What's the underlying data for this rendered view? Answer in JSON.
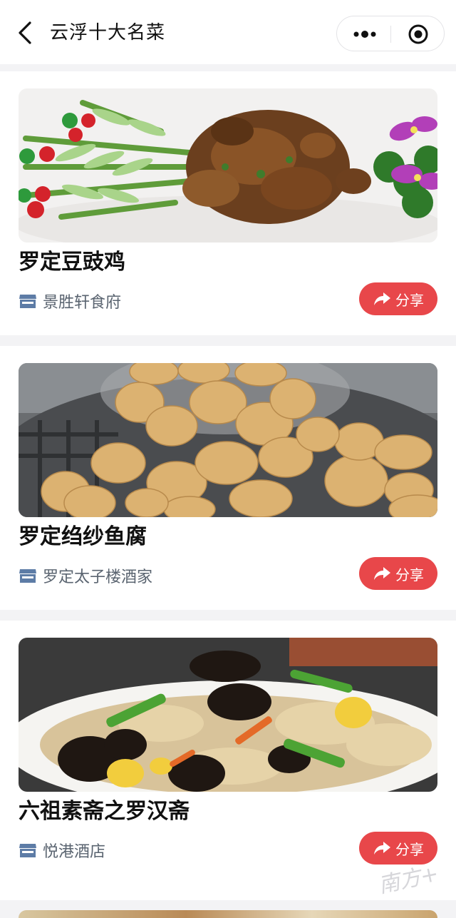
{
  "header": {
    "title": "云浮十大名菜"
  },
  "dishes": [
    {
      "name": "罗定豆豉鸡",
      "shop": "景胜轩食府",
      "share_label": "分享",
      "image": "chicken-dish-photo"
    },
    {
      "name": "罗定绉纱鱼腐",
      "shop": "罗定太子楼酒家",
      "share_label": "分享",
      "image": "fish-ball-dish-photo"
    },
    {
      "name": "六祖素斋之罗汉斋",
      "shop": "悦港酒店",
      "share_label": "分享",
      "image": "vegetarian-dish-photo"
    }
  ],
  "watermark": "南方+",
  "colors": {
    "share": "#e8474a",
    "background": "#f3f3f5",
    "title": "#111111",
    "shop_text": "#5a6470"
  }
}
